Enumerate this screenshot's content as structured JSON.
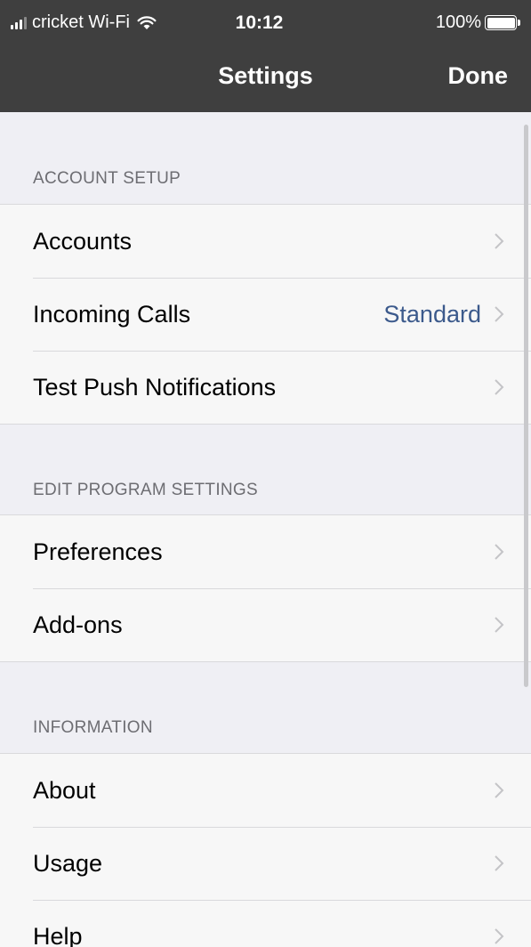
{
  "status_bar": {
    "carrier": "cricket Wi-Fi",
    "time": "10:12",
    "battery": "100%"
  },
  "nav": {
    "title": "Settings",
    "done_label": "Done"
  },
  "sections": [
    {
      "header": "ACCOUNT SETUP",
      "rows": [
        {
          "label": "Accounts",
          "value": ""
        },
        {
          "label": "Incoming Calls",
          "value": "Standard"
        },
        {
          "label": "Test Push Notifications",
          "value": ""
        }
      ]
    },
    {
      "header": "EDIT PROGRAM SETTINGS",
      "rows": [
        {
          "label": "Preferences",
          "value": ""
        },
        {
          "label": "Add-ons",
          "value": ""
        }
      ]
    },
    {
      "header": "INFORMATION",
      "rows": [
        {
          "label": "About",
          "value": ""
        },
        {
          "label": "Usage",
          "value": ""
        },
        {
          "label": "Help",
          "value": ""
        }
      ]
    }
  ],
  "colors": {
    "nav_bg": "#3f3f3f",
    "page_bg": "#efeff4",
    "value_text": "#3c5a8c"
  }
}
